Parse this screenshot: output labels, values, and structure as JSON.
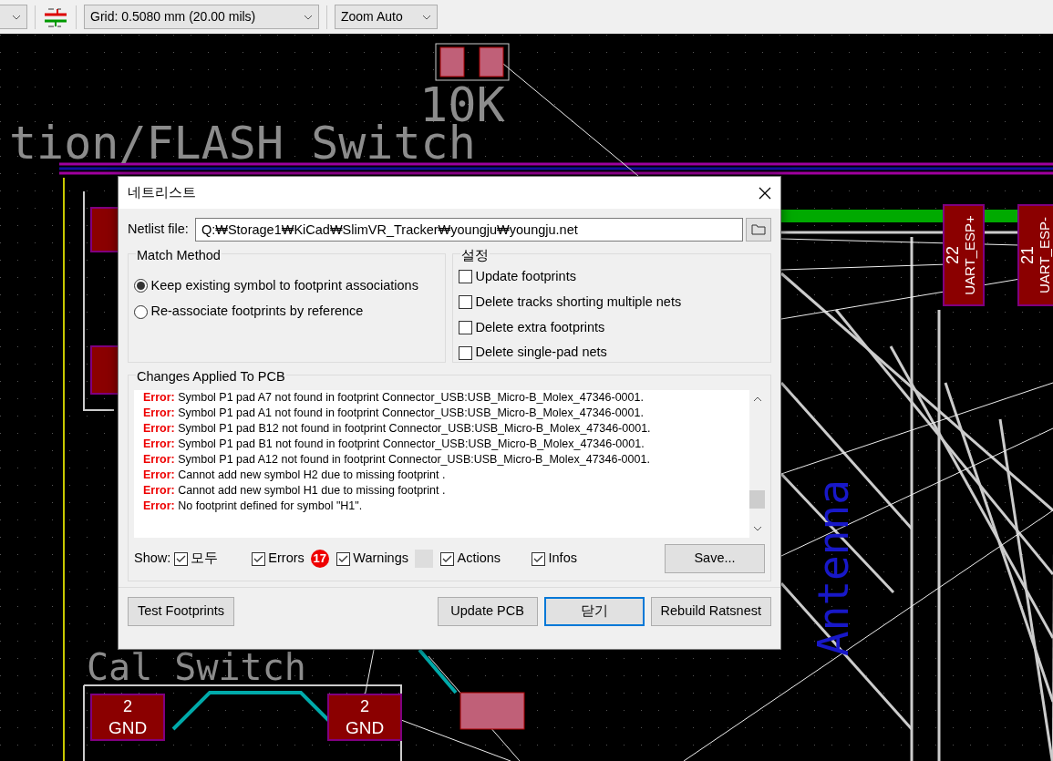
{
  "toolbar": {
    "grid": "Grid: 0.5080 mm (20.00 mils)",
    "zoom": "Zoom Auto"
  },
  "pcb": {
    "labels": [
      {
        "kind": "silk",
        "text": "10K"
      },
      {
        "kind": "silk",
        "text": "tion/FLASH Switch"
      },
      {
        "kind": "silk",
        "text": "Cal Switch"
      },
      {
        "kind": "keepout",
        "text": "Antenna"
      }
    ],
    "pads": [
      {
        "kind": "flat",
        "number": "2",
        "net": "GND"
      },
      {
        "kind": "flat",
        "number": "2",
        "net": "GND"
      },
      {
        "kind": "upright",
        "number": "22",
        "net": "UART_ESP+"
      },
      {
        "kind": "upright",
        "number": "21",
        "net": "UART_ESP-"
      }
    ]
  },
  "dialog": {
    "title": "네트리스트",
    "netlist_label": "Netlist file:",
    "netlist_value": "Q:₩Storage1₩KiCad₩SlimVR_Tracker₩youngju₩youngju.net",
    "match_method": {
      "title": "Match Method",
      "options": [
        {
          "label": "Keep existing symbol to footprint associations",
          "selected": true
        },
        {
          "label": "Re-associate footprints by reference",
          "selected": false
        }
      ]
    },
    "settings": {
      "title": "설정",
      "options": [
        {
          "label": "Update footprints",
          "checked": false
        },
        {
          "label": "Delete tracks shorting multiple nets",
          "checked": false
        },
        {
          "label": "Delete extra footprints",
          "checked": false
        },
        {
          "label": "Delete single-pad nets",
          "checked": false
        }
      ]
    },
    "changes": {
      "title": "Changes Applied To PCB",
      "messages": [
        {
          "severity": "Error:",
          "text": "Symbol P1 pad A7 not found in footprint Connector_USB:USB_Micro-B_Molex_47346-0001."
        },
        {
          "severity": "Error:",
          "text": "Symbol P1 pad A1 not found in footprint Connector_USB:USB_Micro-B_Molex_47346-0001."
        },
        {
          "severity": "Error:",
          "text": "Symbol P1 pad B12 not found in footprint Connector_USB:USB_Micro-B_Molex_47346-0001."
        },
        {
          "severity": "Error:",
          "text": "Symbol P1 pad B1 not found in footprint Connector_USB:USB_Micro-B_Molex_47346-0001."
        },
        {
          "severity": "Error:",
          "text": "Symbol P1 pad A12 not found in footprint Connector_USB:USB_Micro-B_Molex_47346-0001."
        },
        {
          "severity": "Error:",
          "text": "Cannot add new symbol H2 due to missing footprint ."
        },
        {
          "severity": "Error:",
          "text": "Cannot add new symbol H1 due to missing footprint ."
        },
        {
          "severity": "Error:",
          "text": "No footprint defined for symbol \"H1\"."
        }
      ]
    },
    "show": {
      "label": "Show:",
      "filters": [
        {
          "label": "모두",
          "checked": true,
          "kind": "plain"
        },
        {
          "label": "Errors",
          "checked": true,
          "kind": "counted",
          "count": "17"
        },
        {
          "label": "Warnings",
          "checked": true,
          "kind": "uncounted"
        },
        {
          "label": "Actions",
          "checked": true,
          "kind": "plain"
        },
        {
          "label": "Infos",
          "checked": true,
          "kind": "plain"
        }
      ]
    },
    "save": "Save...",
    "buttons": [
      {
        "label": "Test Footprints",
        "default": false
      },
      {
        "label": "Update PCB",
        "default": false
      },
      {
        "label": "닫기",
        "default": true
      },
      {
        "label": "Rebuild Ratsnest",
        "default": false
      }
    ]
  }
}
